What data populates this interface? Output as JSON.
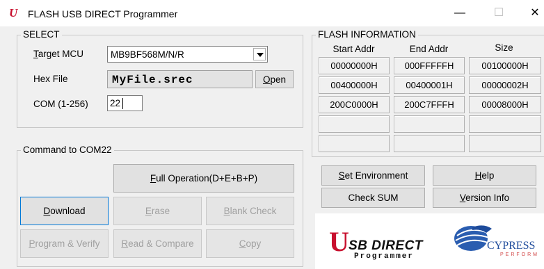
{
  "window": {
    "title": "FLASH USB DIRECT Programmer",
    "app_icon": "U",
    "minimize": "—",
    "maximize": "☐",
    "close": "✕"
  },
  "select": {
    "group_label": "SELECT",
    "target_label": "Target MCU",
    "target_value": "MB9BF568M/N/R",
    "hex_label": "Hex File",
    "hex_value": "MyFile.srec",
    "open_label": "Open",
    "com_label": "COM (1-256)",
    "com_value": "22"
  },
  "flash": {
    "group_label": "FLASH INFORMATION",
    "headers": [
      "Start Addr",
      "End Addr",
      "Size"
    ],
    "rows": [
      [
        "00000000H",
        "000FFFFFH",
        "00100000H"
      ],
      [
        "00400000H",
        "00400001H",
        "00000002H"
      ],
      [
        "200C0000H",
        "200C7FFFH",
        "00008000H"
      ],
      [
        "",
        "",
        ""
      ],
      [
        "",
        "",
        ""
      ]
    ]
  },
  "command": {
    "group_label": "Command to COM22",
    "full_operation": "Full Operation(D+E+B+P)",
    "download": "Download",
    "erase": "Erase",
    "blank_check": "Blank Check",
    "program_verify": "Program & Verify",
    "read_compare": "Read & Compare",
    "copy": "Copy"
  },
  "side_buttons": {
    "set_environment": "Set Environment",
    "help": "Help",
    "check_sum": "Check SUM",
    "version_info": "Version Info"
  },
  "logos": {
    "usb_u": "U",
    "usb_text": "SB DIRECT",
    "usb_sub": "Programmer",
    "cypress_text": "CYPRESS",
    "cypress_sub": "PERFORM"
  },
  "colors": {
    "accent_red": "#c8102e",
    "cypress_blue": "#1e4b9b",
    "focus_blue": "#0078d7"
  }
}
